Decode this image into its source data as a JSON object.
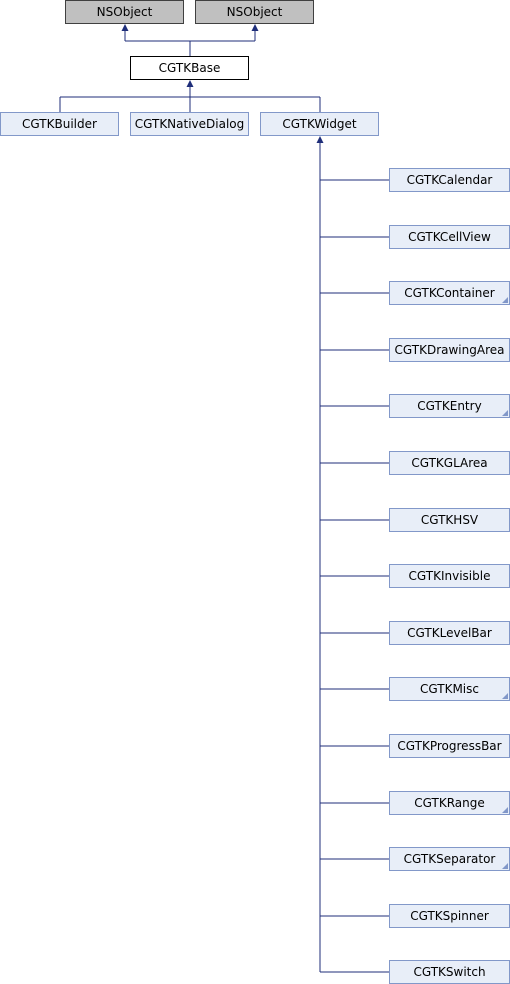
{
  "diagram": {
    "colors": {
      "edge": "#1f2e7a",
      "gray_fill": "#c0c0c0",
      "blue_fill": "#e8eef8",
      "blue_border": "#8298c9"
    },
    "roots": [
      {
        "id": "nsobject-1",
        "label": "NSObject"
      },
      {
        "id": "nsobject-2",
        "label": "NSObject"
      }
    ],
    "base": {
      "id": "cgtkbase",
      "label": "CGTKBase"
    },
    "children": [
      {
        "id": "cgtkbuilder",
        "label": "CGTKBuilder"
      },
      {
        "id": "cgtknativedialog",
        "label": "CGTKNativeDialog"
      },
      {
        "id": "cgtkwidget",
        "label": "CGTKWidget"
      }
    ],
    "widget_subclasses": [
      {
        "label": "CGTKCalendar",
        "has_more": false
      },
      {
        "label": "CGTKCellView",
        "has_more": false
      },
      {
        "label": "CGTKContainer",
        "has_more": true
      },
      {
        "label": "CGTKDrawingArea",
        "has_more": false
      },
      {
        "label": "CGTKEntry",
        "has_more": true
      },
      {
        "label": "CGTKGLArea",
        "has_more": false
      },
      {
        "label": "CGTKHSV",
        "has_more": false
      },
      {
        "label": "CGTKInvisible",
        "has_more": false
      },
      {
        "label": "CGTKLevelBar",
        "has_more": false
      },
      {
        "label": "CGTKMisc",
        "has_more": true
      },
      {
        "label": "CGTKProgressBar",
        "has_more": false
      },
      {
        "label": "CGTKRange",
        "has_more": true
      },
      {
        "label": "CGTKSeparator",
        "has_more": true
      },
      {
        "label": "CGTKSpinner",
        "has_more": false
      },
      {
        "label": "CGTKSwitch",
        "has_more": false
      }
    ]
  }
}
